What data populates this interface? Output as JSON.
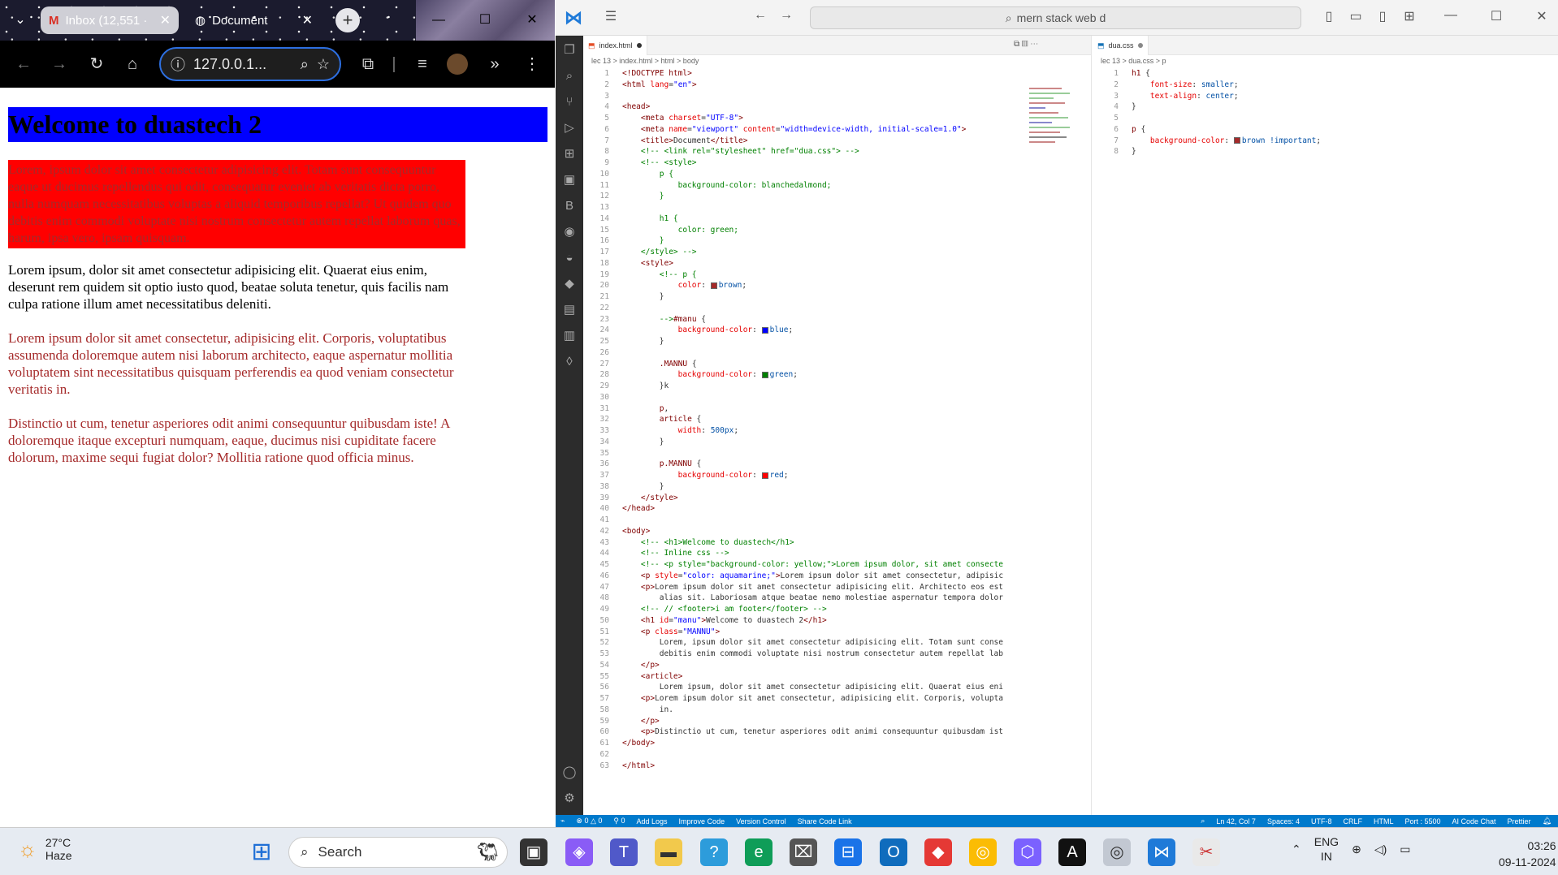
{
  "browser": {
    "tabs": [
      {
        "label": "Inbox (12,551 ·",
        "icon": "gmail-icon"
      },
      {
        "label": "Document",
        "icon": "document-icon"
      }
    ],
    "address": "127.0.0.1...",
    "page": {
      "heading": "Welcome to duastech 2",
      "mannu_paragraph": "Lorem, ipsum dolor sit amet consectetur adipisicing elit. Totam sunt consequuntur eaque ut ducimus repellendus qui odit, consequatur eveniet ab veritatis dicta porro, nulla numquam necessitatibus voluptas a aliquid temporibus repellat? Ut quidem quo debitis enim commodi voluptate nisi nostrum consectetur autem repellat laborum quas, harum, ipsa vero, ipsam quisquam.",
      "article": "Lorem ipsum, dolor sit amet consectetur adipisicing elit. Quaerat eius enim, deserunt rem quidem sit optio iusto quod, beatae soluta tenetur, quis facilis nam culpa ratione illum amet necessitatibus deleniti.",
      "paragraph_1": "Lorem ipsum dolor sit amet consectetur, adipisicing elit. Corporis, voluptatibus assumenda doloremque autem nisi laborum architecto, eaque aspernatur mollitia voluptatem sint necessitatibus quisquam perferendis ea quod veniam consectetur veritatis in.",
      "paragraph_2": "Distinctio ut cum, tenetur asperiores odit animi consequuntur quibusdam iste! A doloremque itaque excepturi numquam, eaque, ducimus nisi cupiditate facere dolorum, maxime sequi fugiat dolor? Mollitia ratione quod officia minus."
    }
  },
  "vscode": {
    "search": "mern stack web d",
    "left_tab": "index.html",
    "left_breadcrumb": "lec 13 > index.html > html > body",
    "right_tab": "dua.css",
    "right_breadcrumb": "lec 13 > dua.css > p",
    "status": {
      "problems": "0 △ 0",
      "ports_count": "0",
      "add_logs": "Add Logs",
      "improve_code": "Improve Code",
      "version_control": "Version Control",
      "share": "Share Code Link",
      "position": "Ln 42, Col 7",
      "spaces": "Spaces: 4",
      "encoding": "UTF-8",
      "eol": "CRLF",
      "language": "HTML",
      "port": "Port : 5500",
      "ai_chat": "AI Code Chat",
      "prettier": "Prettier"
    }
  },
  "taskbar": {
    "temp": "27°C",
    "weather": "Haze",
    "search_placeholder": "Search",
    "lang": "ENG",
    "region": "IN",
    "time": "03:26",
    "date": "09-11-2024"
  },
  "colors": {
    "heading_bg": "#0000ff",
    "mannu_bg": "#ff0000",
    "brown": "#a52a2a",
    "vscode_status": "#007acc"
  }
}
